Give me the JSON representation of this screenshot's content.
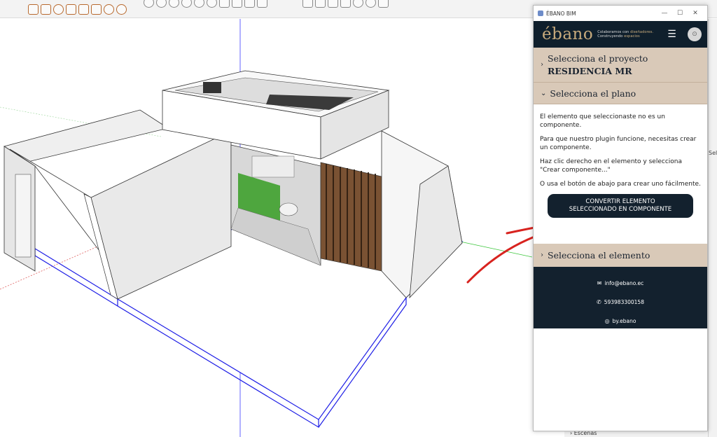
{
  "window": {
    "title": "ÉBANO BIM",
    "minimize": "—",
    "maximize": "☐",
    "close": "✕"
  },
  "header": {
    "logo": "ébano",
    "tagline_line1": "Colaboramos con",
    "tagline_highlight1": "diseñadores.",
    "tagline_line2": "Construyendo",
    "tagline_highlight2": "espacios",
    "menu_icon": "☰",
    "avatar": "⊙"
  },
  "project_section": {
    "chevron": "›",
    "label": "Selecciona el proyecto",
    "value": "RESIDENCIA MR"
  },
  "plano_section": {
    "chevron": "⌄",
    "label": "Selecciona el plano"
  },
  "message": {
    "p1": "El elemento que seleccionaste no es un componente.",
    "p2": "Para que nuestro plugin funcione, necesitas crear un componente.",
    "p3": "Haz clic derecho en el elemento y selecciona \"Crear componente...\"",
    "p4": "O usa el botón de abajo para crear uno fácilmente."
  },
  "convert_button": {
    "line1": "CONVERTIR ELEMENTO",
    "line2": "SELECCIONADO EN COMPONENTE"
  },
  "elemento_section": {
    "chevron": "›",
    "label": "Selecciona el elemento"
  },
  "footer": {
    "email_icon": "✉",
    "email": "info@ebano.ec",
    "phone_icon": "✆",
    "phone": "593983300158",
    "instagram_icon": "◎",
    "instagram": "by.ebano"
  },
  "tray": {
    "side_text": "Selo",
    "bottom_text": "› Escenas"
  },
  "colors": {
    "brand_dark": "#13212e",
    "brand_gold": "#c7aa7c",
    "section_beige": "#d9c9b8",
    "annotation_red": "#d8231f",
    "selection_blue": "#1a1aee"
  }
}
